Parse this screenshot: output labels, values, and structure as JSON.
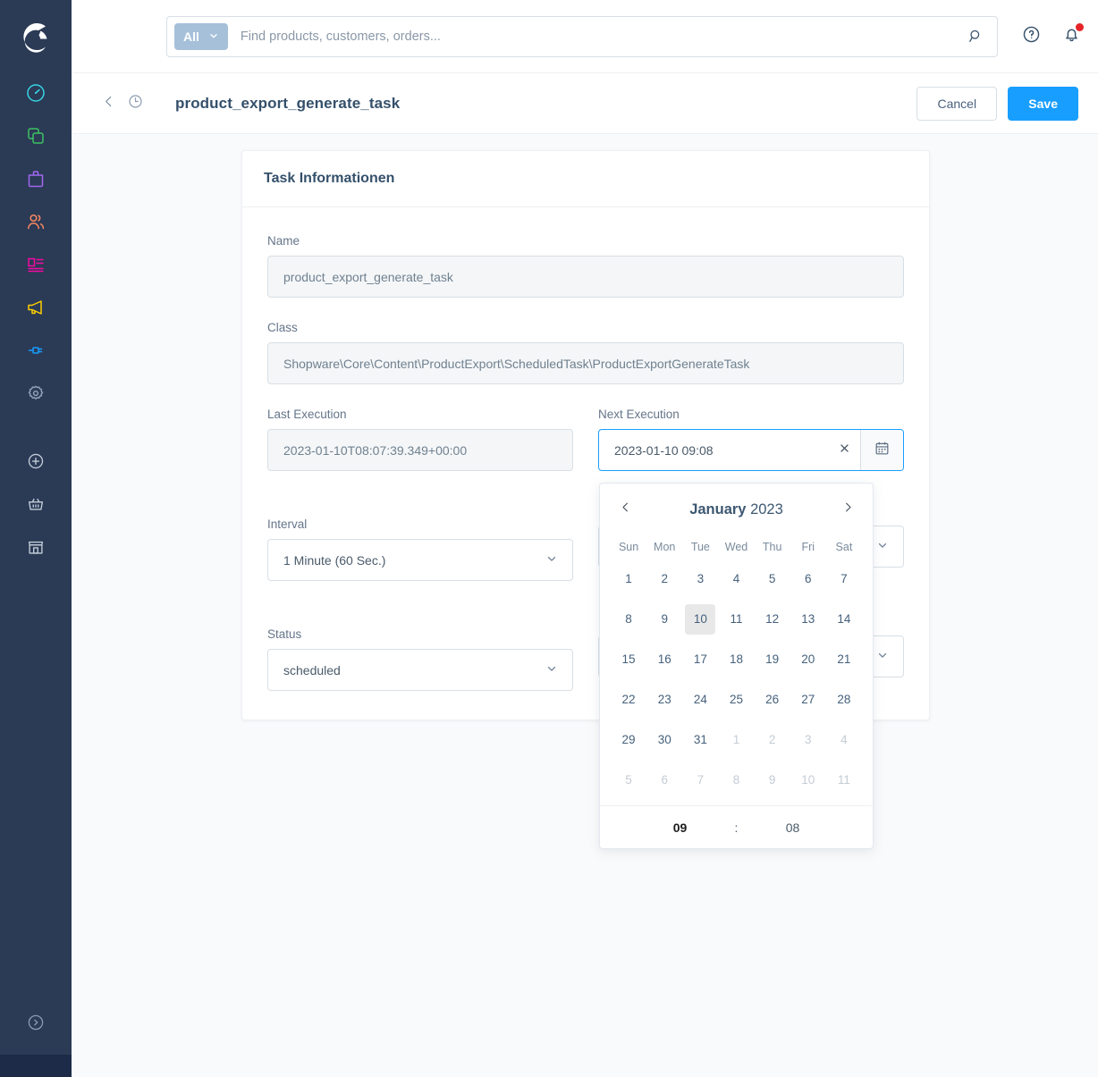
{
  "colors": {
    "sidebar_bg": "#2b3a55",
    "accent": "#189eff",
    "page_bg": "#f9fafb",
    "heading": "#35506b"
  },
  "sidebar": {
    "logo_name": "shopware-logo",
    "items": [
      {
        "name": "dashboard",
        "icon": "speedometer-icon",
        "color": "#37d4e3"
      },
      {
        "name": "catalogues",
        "icon": "layers-icon",
        "color": "#3cc261"
      },
      {
        "name": "orders",
        "icon": "bag-icon",
        "color": "#a168f0"
      },
      {
        "name": "customers",
        "icon": "people-icon",
        "color": "#f88962"
      },
      {
        "name": "content",
        "icon": "content-icon",
        "color": "#f20aa2"
      },
      {
        "name": "marketing",
        "icon": "megaphone-icon",
        "color": "#fcd000"
      },
      {
        "name": "extensions",
        "icon": "plug-icon",
        "color": "#189eff"
      },
      {
        "name": "settings",
        "icon": "gear-icon",
        "color": "#90a0b5"
      }
    ],
    "secondary": [
      {
        "name": "add",
        "icon": "plus-circle-icon",
        "color": "#c2ccd8"
      },
      {
        "name": "basket",
        "icon": "basket-icon",
        "color": "#c2ccd8"
      },
      {
        "name": "storefront",
        "icon": "storefront-icon",
        "color": "#c2ccd8"
      }
    ],
    "expand": {
      "name": "expand-sidebar",
      "icon": "chevron-right-circle-icon"
    }
  },
  "topbar": {
    "scope_label": "All",
    "scope_icon": "chevron-down-icon",
    "search_placeholder": "Find products, customers, orders...",
    "search_value": "",
    "search_icon": "search-icon",
    "help_icon": "question-circle-icon",
    "notifications_icon": "bell-icon",
    "has_notification": true
  },
  "pageheader": {
    "back_icon": "chevron-left-icon",
    "history_icon": "clock-icon",
    "title": "product_export_generate_task",
    "cancel_label": "Cancel",
    "save_label": "Save"
  },
  "card": {
    "title": "Task Informationen",
    "fields": {
      "name": {
        "label": "Name",
        "value": "product_export_generate_task"
      },
      "class": {
        "label": "Class",
        "value": "Shopware\\Core\\Content\\ProductExport\\ScheduledTask\\ProductExportGenerateTask"
      },
      "last_execution": {
        "label": "Last Execution",
        "value": "2023-01-10T08:07:39.349+00:00"
      },
      "next_execution": {
        "label": "Next Execution",
        "value": "2023-01-10 09:08",
        "clear_icon": "close-icon",
        "calendar_icon": "calendar-icon"
      },
      "interval": {
        "label": "Interval",
        "value": "1 Minute (60 Sec.)",
        "icon": "chevron-down-icon"
      },
      "status": {
        "label": "Status",
        "value": "scheduled",
        "icon": "chevron-down-icon"
      },
      "hidden_right_top": {
        "label": ""
      },
      "hidden_right_bottom": {
        "label": ""
      }
    }
  },
  "datepicker": {
    "prev_icon": "chevron-left-icon",
    "next_icon": "chevron-right-icon",
    "month": "January",
    "year": "2023",
    "weekdays": [
      "Sun",
      "Mon",
      "Tue",
      "Wed",
      "Thu",
      "Fri",
      "Sat"
    ],
    "weeks": [
      [
        {
          "d": "1",
          "m": false,
          "s": false
        },
        {
          "d": "2",
          "m": false,
          "s": false
        },
        {
          "d": "3",
          "m": false,
          "s": false
        },
        {
          "d": "4",
          "m": false,
          "s": false
        },
        {
          "d": "5",
          "m": false,
          "s": false
        },
        {
          "d": "6",
          "m": false,
          "s": false
        },
        {
          "d": "7",
          "m": false,
          "s": false
        }
      ],
      [
        {
          "d": "8",
          "m": false,
          "s": false
        },
        {
          "d": "9",
          "m": false,
          "s": false
        },
        {
          "d": "10",
          "m": false,
          "s": true
        },
        {
          "d": "11",
          "m": false,
          "s": false
        },
        {
          "d": "12",
          "m": false,
          "s": false
        },
        {
          "d": "13",
          "m": false,
          "s": false
        },
        {
          "d": "14",
          "m": false,
          "s": false
        }
      ],
      [
        {
          "d": "15",
          "m": false,
          "s": false
        },
        {
          "d": "16",
          "m": false,
          "s": false
        },
        {
          "d": "17",
          "m": false,
          "s": false
        },
        {
          "d": "18",
          "m": false,
          "s": false
        },
        {
          "d": "19",
          "m": false,
          "s": false
        },
        {
          "d": "20",
          "m": false,
          "s": false
        },
        {
          "d": "21",
          "m": false,
          "s": false
        }
      ],
      [
        {
          "d": "22",
          "m": false,
          "s": false
        },
        {
          "d": "23",
          "m": false,
          "s": false
        },
        {
          "d": "24",
          "m": false,
          "s": false
        },
        {
          "d": "25",
          "m": false,
          "s": false
        },
        {
          "d": "26",
          "m": false,
          "s": false
        },
        {
          "d": "27",
          "m": false,
          "s": false
        },
        {
          "d": "28",
          "m": false,
          "s": false
        }
      ],
      [
        {
          "d": "29",
          "m": false,
          "s": false
        },
        {
          "d": "30",
          "m": false,
          "s": false
        },
        {
          "d": "31",
          "m": false,
          "s": false
        },
        {
          "d": "1",
          "m": true,
          "s": false
        },
        {
          "d": "2",
          "m": true,
          "s": false
        },
        {
          "d": "3",
          "m": true,
          "s": false
        },
        {
          "d": "4",
          "m": true,
          "s": false
        }
      ],
      [
        {
          "d": "5",
          "m": true,
          "s": false
        },
        {
          "d": "6",
          "m": true,
          "s": false
        },
        {
          "d": "7",
          "m": true,
          "s": false
        },
        {
          "d": "8",
          "m": true,
          "s": false
        },
        {
          "d": "9",
          "m": true,
          "s": false
        },
        {
          "d": "10",
          "m": true,
          "s": false
        },
        {
          "d": "11",
          "m": true,
          "s": false
        }
      ]
    ],
    "time": {
      "hour": "09",
      "separator": ":",
      "minute": "08"
    }
  }
}
